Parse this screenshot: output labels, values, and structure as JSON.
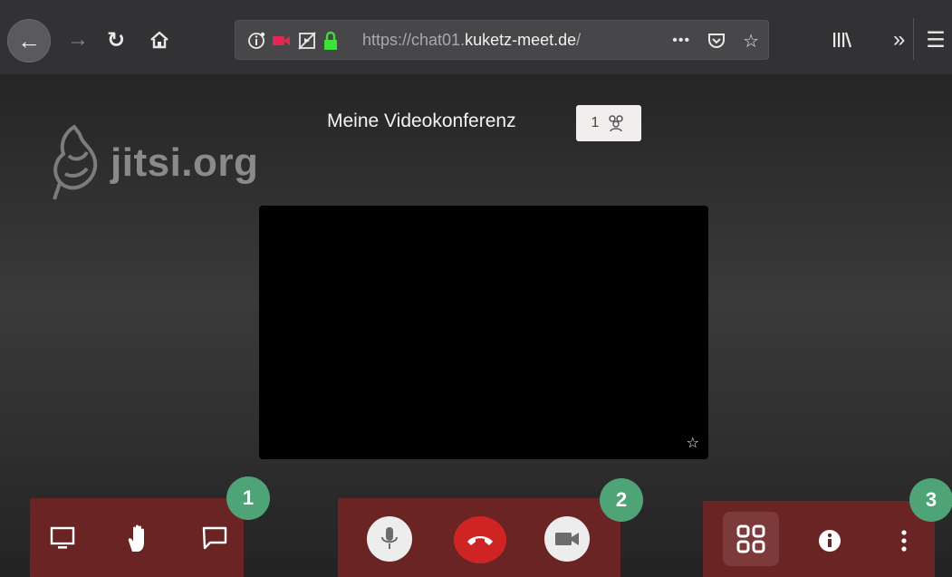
{
  "browser": {
    "url_prefix": "https://chat01.",
    "url_domain": "kuketz-meet.de",
    "url_suffix": "/",
    "page_actions": "•••"
  },
  "meeting": {
    "logo_text": "jitsi.org",
    "title": "Meine Videokonferenz",
    "participant_count": "1"
  },
  "toolbar_markers": {
    "left": "1",
    "center": "2",
    "right": "3"
  },
  "colors": {
    "toolbar_bg": "#6a2424",
    "hangup": "#cf2424",
    "marker": "#4fa477"
  },
  "icons": {
    "left_toolbar": [
      "screenshare-icon",
      "raise-hand-icon",
      "chat-icon"
    ],
    "center_toolbar": [
      "microphone-icon",
      "hangup-icon",
      "camera-icon"
    ],
    "right_toolbar": [
      "tile-view-icon",
      "info-icon",
      "more-options-icon"
    ]
  }
}
